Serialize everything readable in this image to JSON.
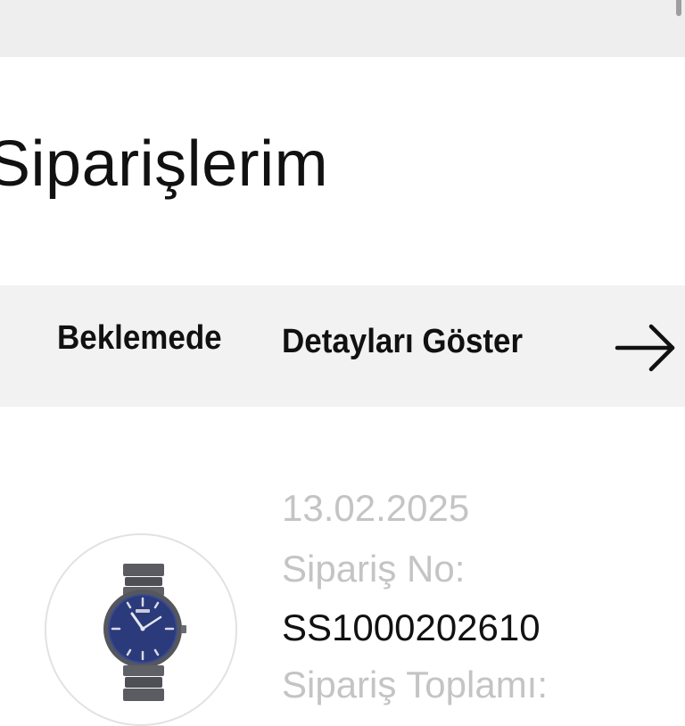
{
  "page": {
    "title": "Siparişlerim"
  },
  "order": {
    "status": "Beklemede",
    "details_link": "Detayları Göster",
    "date": "13.02.2025",
    "order_no_label": "Sipariş No:",
    "order_no": "SS1000202610",
    "total_label": "Sipariş Toplamı:"
  },
  "icons": {
    "arrow": "arrow-right-icon",
    "product": "watch-product-image"
  },
  "colors": {
    "status_bar_bg": "#f2f2f2",
    "top_bar_bg": "#eeeeee",
    "muted_text": "#c4c4c4",
    "primary_text": "#111111",
    "watch_dial": "#2b3a7a"
  }
}
